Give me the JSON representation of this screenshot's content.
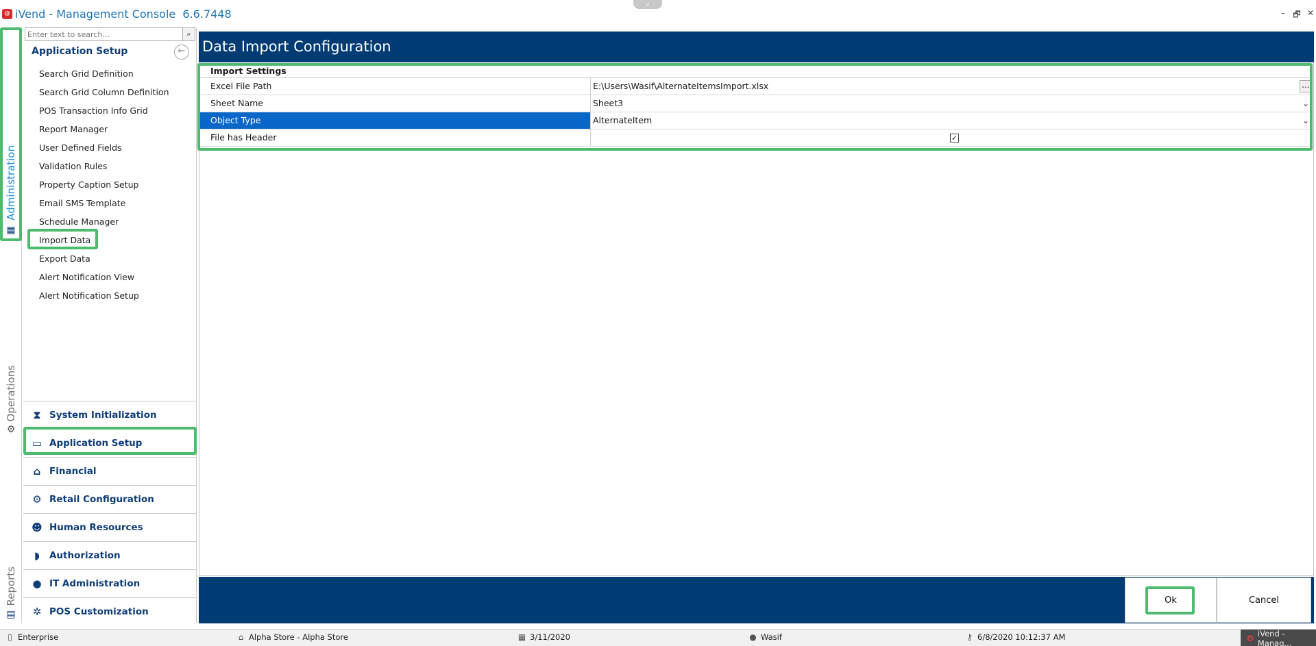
{
  "titlebar": {
    "title": "iVend - Management Console  6.6.7448",
    "handle_icon": "chevron-down-icon",
    "minimize": "–",
    "restore": "🗗",
    "close": "✕"
  },
  "rail": {
    "tabs": [
      {
        "label": "Administration",
        "icon": "building-icon",
        "color": "#1d8fd4"
      },
      {
        "label": "Operations",
        "icon": "gear-icon",
        "color": "#777777"
      },
      {
        "label": "Reports",
        "icon": "report-icon",
        "color": "#777777"
      }
    ]
  },
  "sidebar": {
    "search_placeholder": "Enter text to search...",
    "section_title": "Application Setup",
    "items": [
      {
        "label": "Search Grid Definition"
      },
      {
        "label": "Search Grid Column Definition"
      },
      {
        "label": "POS Transaction Info Grid"
      },
      {
        "label": "Report Manager"
      },
      {
        "label": "User Defined Fields"
      },
      {
        "label": "Validation Rules"
      },
      {
        "label": "Property Caption Setup"
      },
      {
        "label": "Email SMS Template"
      },
      {
        "label": "Schedule Manager"
      },
      {
        "label": "Import Data"
      },
      {
        "label": "Export Data"
      },
      {
        "label": "Alert Notification View"
      },
      {
        "label": "Alert Notification Setup"
      }
    ],
    "modules": [
      {
        "label": "System Initialization",
        "icon": "hourglass-icon"
      },
      {
        "label": "Application Setup",
        "icon": "terminal-window-icon"
      },
      {
        "label": "Financial",
        "icon": "bank-icon"
      },
      {
        "label": "Retail Configuration",
        "icon": "gears-icon"
      },
      {
        "label": "Human Resources",
        "icon": "person-search-icon"
      },
      {
        "label": "Authorization",
        "icon": "shield-icon"
      },
      {
        "label": "IT Administration",
        "icon": "user-icon"
      },
      {
        "label": "POS Customization",
        "icon": "customize-icon"
      }
    ]
  },
  "main": {
    "title": "Data Import Configuration",
    "category": "Import Settings",
    "rows": [
      {
        "key": "Excel File Path",
        "value": "E:\\Users\\Wasif\\AlternateItemsImport.xlsx",
        "editor": "ellipsis"
      },
      {
        "key": "Sheet Name",
        "value": "Sheet3",
        "editor": "dropdown"
      },
      {
        "key": "Object Type",
        "value": "AlternateItem",
        "editor": "dropdown"
      },
      {
        "key": "File has Header",
        "value": "",
        "editor": "checkbox",
        "checked": true
      }
    ],
    "ok_label": "Ok",
    "cancel_label": "Cancel"
  },
  "statusbar": {
    "enterprise": "Enterprise",
    "store": "Alpha Store - Alpha Store",
    "date": "3/11/2020",
    "user": "Wasif",
    "login_time": "6/8/2020 10:12:37 AM",
    "task": "iVend - Manag..."
  },
  "colors": {
    "accent_dark": "#003b73",
    "selection": "#0a67c8",
    "highlight": "#4cbb6e",
    "title_text": "#1d74b8"
  }
}
